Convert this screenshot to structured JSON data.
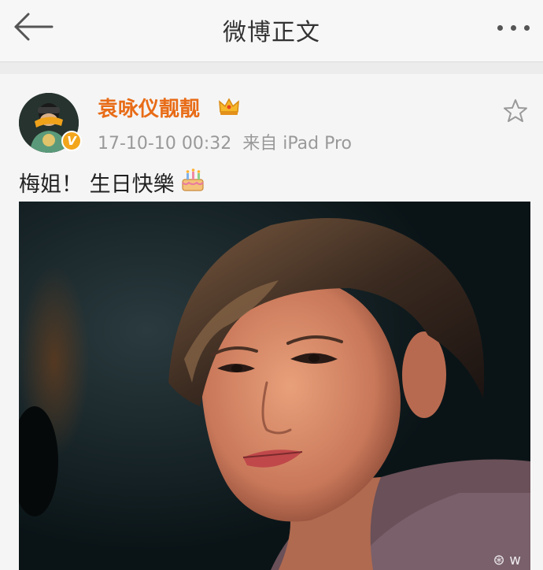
{
  "header": {
    "title": "微博正文",
    "back_icon": "back-arrow-icon",
    "more_icon": "more-dots-icon"
  },
  "post": {
    "username": "袁咏仪靓靓",
    "badge_icon": "crown-icon",
    "verified_icon": "verified-v-icon",
    "timestamp": "17-10-10 00:32",
    "source": "来自 iPad Pro",
    "text": "梅姐！ 生日快樂",
    "emoji_icon": "birthday-cake-icon",
    "favorite_icon": "star-icon",
    "watermark": "⊛ w"
  },
  "colors": {
    "username": "#e86c17",
    "meta": "#999999",
    "header_bg": "#f7f7f7"
  }
}
